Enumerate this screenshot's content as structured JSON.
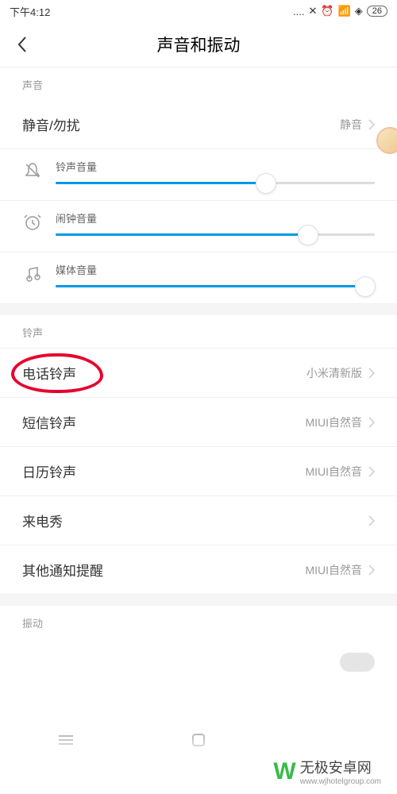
{
  "status": {
    "time": "下午4:12",
    "battery": "26"
  },
  "header": {
    "title": "声音和振动"
  },
  "sections": {
    "sound_label": "声音",
    "silent": {
      "label": "静音/勿扰",
      "value": "静音"
    },
    "sliders": {
      "ringtone": {
        "label": "铃声音量",
        "pct": 66
      },
      "alarm": {
        "label": "闹钟音量",
        "pct": 79
      },
      "media": {
        "label": "媒体音量",
        "pct": 97
      }
    },
    "ringtones_label": "铃声",
    "phone": {
      "label": "电话铃声",
      "value": "小米清新版"
    },
    "sms": {
      "label": "短信铃声",
      "value": "MIUI自然音"
    },
    "calendar": {
      "label": "日历铃声",
      "value": "MIUI自然音"
    },
    "callshow": {
      "label": "来电秀",
      "value": ""
    },
    "other": {
      "label": "其他通知提醒",
      "value": "MIUI自然音"
    },
    "vibrate_label": "振动"
  },
  "watermark": {
    "main": "无极安卓网",
    "sub": "www.wjhotelgroup.com"
  }
}
